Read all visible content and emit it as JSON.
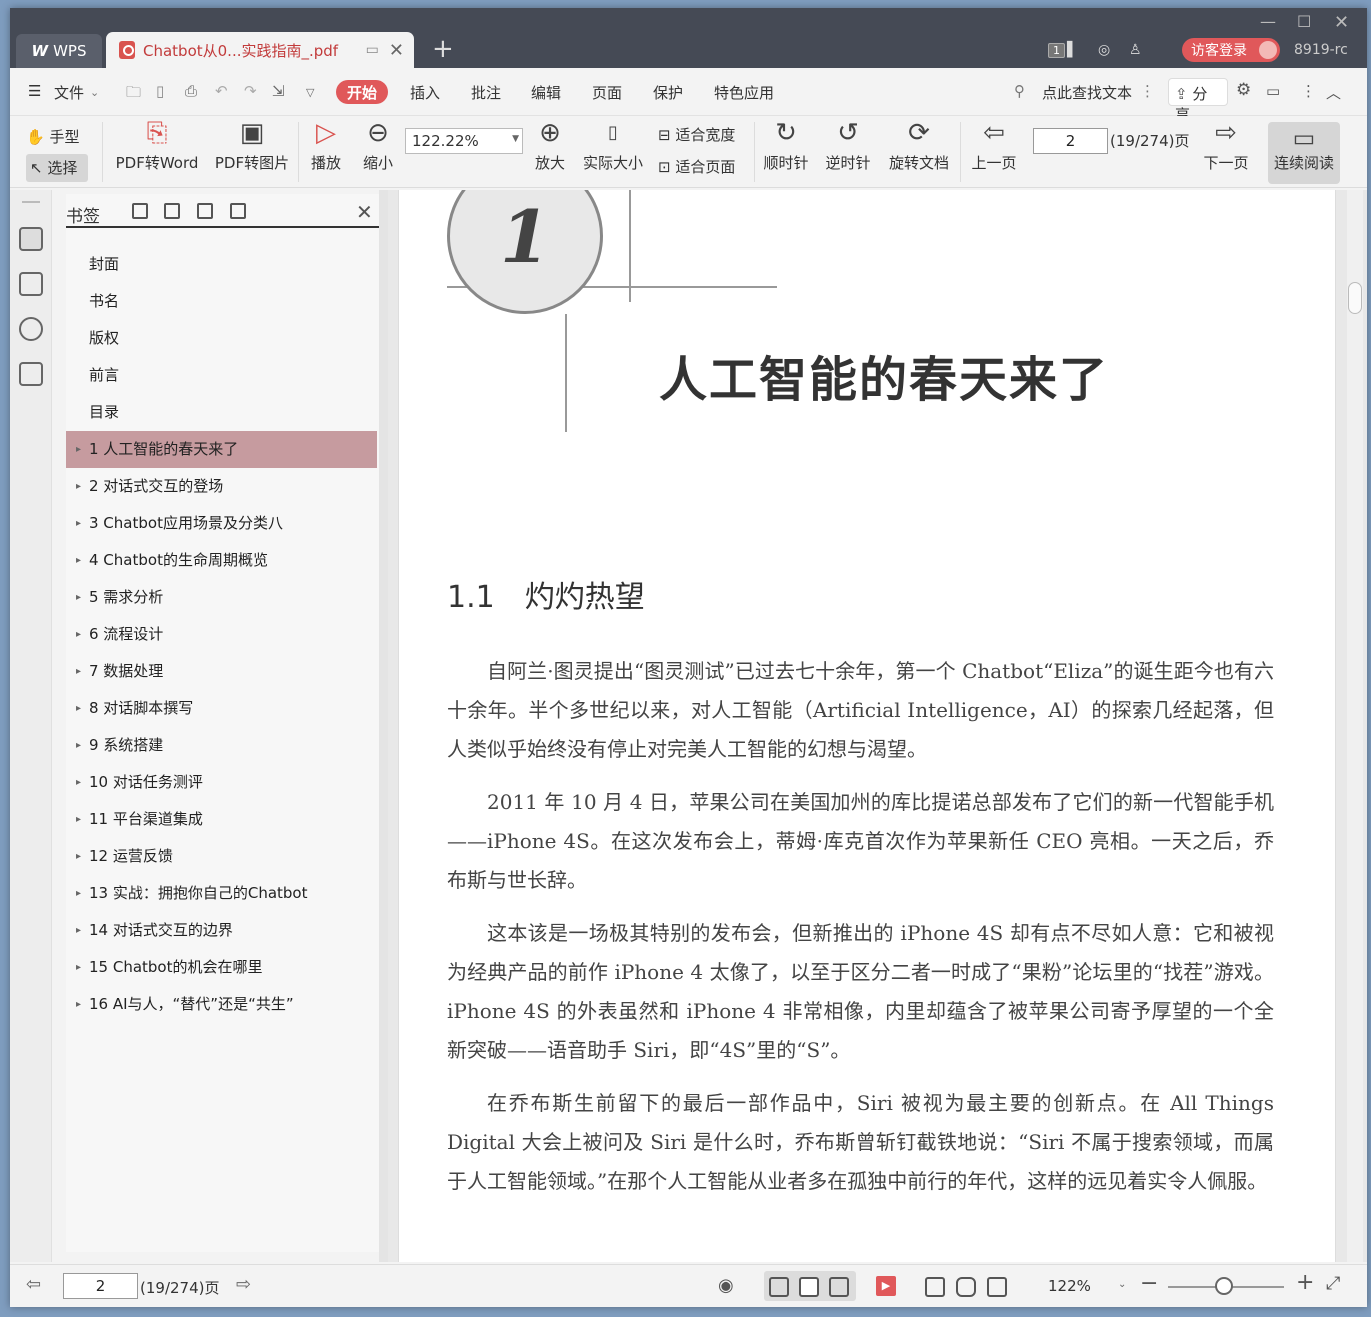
{
  "window": {
    "app_tab": "WPS",
    "doc_tab": "Chatbot从0...实践指南_.pdf",
    "version": "8919-rc",
    "page_count_badge": "1",
    "login": "访客登录"
  },
  "menu": {
    "file": "文件",
    "items": [
      "开始",
      "插入",
      "批注",
      "编辑",
      "页面",
      "保护",
      "特色应用"
    ],
    "search": "点此查找文本",
    "share": "分享"
  },
  "ribbon": {
    "hand": "手型",
    "select": "选择",
    "pdf2word": "PDF转Word",
    "pdf2img": "PDF转图片",
    "play": "播放",
    "zoom_out": "缩小",
    "zoom_value": "122.22%",
    "zoom_in": "放大",
    "actual_size": "实际大小",
    "fit_width": "适合宽度",
    "fit_page": "适合页面",
    "clockwise": "顺时针",
    "counter": "逆时针",
    "rotate": "旋转文档",
    "prev": "上一页",
    "page": "2",
    "page_info": "(19/274)页",
    "next": "下一页",
    "continuous": "连续阅读"
  },
  "bookmarks": {
    "title": "书签",
    "items": [
      "封面",
      "书名",
      "版权",
      "前言",
      "目录",
      "1 人工智能的春天来了",
      "2 对话式交互的登场",
      "3 Chatbot应用场景及分类八",
      "4 Chatbot的生命周期概览",
      "5 需求分析",
      "6 流程设计",
      "7 数据处理",
      "8 对话脚本撰写",
      "9 系统搭建",
      "10 对话任务测评",
      "11 平台渠道集成",
      "12 运营反馈",
      "13 实战：拥抱你自己的Chatbot",
      "14 对话式交互的边界",
      "15 Chatbot的机会在哪里",
      "16 AI与人，“替代”还是“共生”"
    ]
  },
  "page": {
    "chapter_num": "1",
    "chapter_title": "人工智能的春天来了",
    "section": "1.1　灼灼热望",
    "p1": "自阿兰·图灵提出“图灵测试”已过去七十余年，第一个 Chatbot“Eliza”的诞生距今也有六十余年。半个多世纪以来，对人工智能（Artificial Intelligence，AI）的探索几经起落，但人类似乎始终没有停止对完美人工智能的幻想与渴望。",
    "p2": "2011 年 10 月 4 日，苹果公司在美国加州的库比提诺总部发布了它们的新一代智能手机——iPhone 4S。在这次发布会上，蒂姆·库克首次作为苹果新任 CEO 亮相。一天之后，乔布斯与世长辞。",
    "p3": "这本该是一场极其特别的发布会，但新推出的 iPhone 4S 却有点不尽如人意：它和被视为经典产品的前作 iPhone 4 太像了，以至于区分二者一时成了“果粉”论坛里的“找茬”游戏。iPhone 4S 的外表虽然和 iPhone 4 非常相像，内里却蕴含了被苹果公司寄予厚望的一个全新突破——语音助手 Siri，即“4S”里的“S”。",
    "p4": "在乔布斯生前留下的最后一部作品中，Siri 被视为最主要的创新点。在 All Things Digital 大会上被问及 Siri 是什么时，乔布斯曾斩钉截铁地说：“Siri 不属于搜索领域，而属于人工智能领域。”在那个人工智能从业者多在孤独中前行的年代，这样的远见着实令人佩服。"
  },
  "status": {
    "page": "2",
    "page_info": "(19/274)页",
    "zoom": "122%"
  }
}
